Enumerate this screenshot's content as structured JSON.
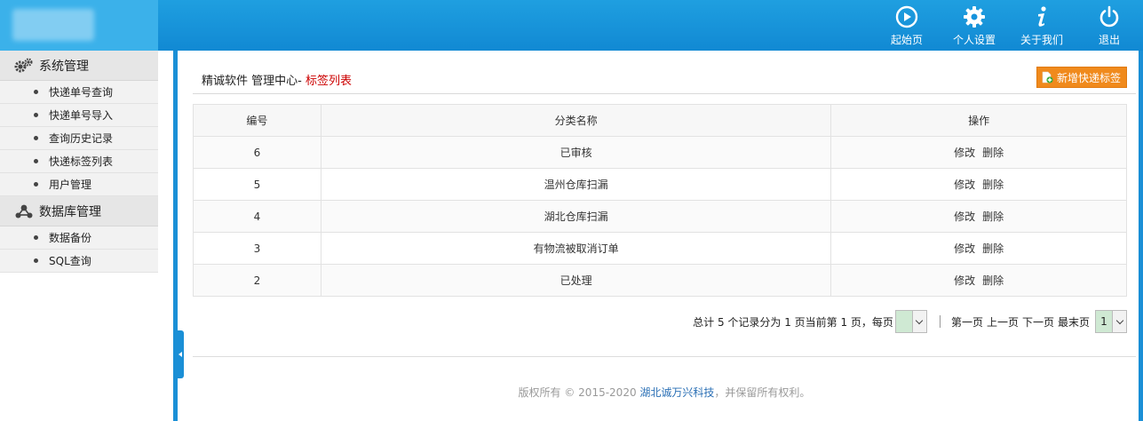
{
  "nav": [
    {
      "label": "起始页",
      "icon": "play-icon"
    },
    {
      "label": "个人设置",
      "icon": "gear-icon"
    },
    {
      "label": "关于我们",
      "icon": "info-icon"
    },
    {
      "label": "退出",
      "icon": "power-icon"
    }
  ],
  "sidebar": {
    "sections": [
      {
        "title": "系统管理",
        "icon": "gears-icon",
        "items": [
          "快递单号查询",
          "快递单号导入",
          "查询历史记录",
          "快递标签列表",
          "用户管理"
        ]
      },
      {
        "title": "数据库管理",
        "icon": "share-nodes-icon",
        "items": [
          "数据备份",
          "SQL查询"
        ]
      }
    ]
  },
  "main": {
    "title_prefix": "精诚软件 管理中心- ",
    "title_current": "标签列表",
    "add_button": "新增快递标签"
  },
  "table": {
    "headers": [
      "编号",
      "分类名称",
      "操作"
    ],
    "rows": [
      {
        "id": "6",
        "name": "已审核"
      },
      {
        "id": "5",
        "name": "温州仓库扫漏"
      },
      {
        "id": "4",
        "name": "湖北仓库扫漏"
      },
      {
        "id": "3",
        "name": "有物流被取消订单"
      },
      {
        "id": "2",
        "name": "已处理"
      }
    ],
    "edit_label": "修改",
    "delete_label": "删除"
  },
  "pager": {
    "summary": "总计 5 个记录分为 1 页当前第 1 页，每页",
    "per_page_value": "",
    "first": "第一页",
    "prev": "上一页",
    "next": "下一页",
    "last": "最末页",
    "page_value": "1"
  },
  "footer": {
    "prefix": "版权所有 © 2015-2020 ",
    "company": "湖北诚万兴科技",
    "suffix": "，并保留所有权利。"
  },
  "colors": {
    "header": "#1a94db",
    "accent_orange": "#f08a1c",
    "title_red": "#cc0000"
  }
}
